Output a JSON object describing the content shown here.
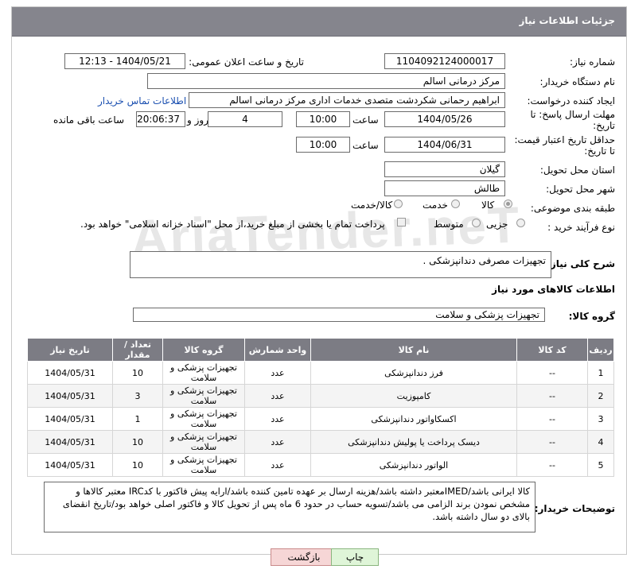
{
  "header": {
    "title": "جزئیات اطلاعات نیاز"
  },
  "fields": {
    "need_number_label": "شماره نیاز:",
    "need_number": "1104092124000017",
    "announce_label": "تاریخ و ساعت اعلان عمومی:",
    "announce_value": "1404/05/21 - 12:13",
    "buyer_org_label": "نام دستگاه خریدار:",
    "buyer_org": "مرکز درمانی اسالم",
    "creator_label": "ایجاد کننده درخواست:",
    "creator": "ابراهیم رحمانی شکردشت متصدی خدمات اداری مرکز درمانی اسالم",
    "contact_link": "اطلاعات تماس خریدار",
    "deadline_label_1": "مهلت ارسال پاسخ: تا",
    "deadline_label_2": "تاریخ:",
    "deadline_date": "1404/05/26",
    "time_label": "ساعت",
    "deadline_time": "10:00",
    "days_value": "4",
    "days_label": "روز و",
    "remaining_time": "20:06:37",
    "remaining_label": "ساعت باقی مانده",
    "validity_label_1": "حداقل تاریخ اعتبار قیمت:",
    "validity_label_2": "تا تاریخ:",
    "validity_date": "1404/06/31",
    "validity_time": "10:00",
    "province_label": "استان محل تحویل:",
    "province": "گیلان",
    "city_label": "شهر محل تحویل:",
    "city": "طالش",
    "category_label": "طبقه بندی موضوعی:",
    "category_options": [
      "کالا",
      "خدمت",
      "کالا/خدمت"
    ],
    "process_label": "نوع فرآیند خرید :",
    "process_options": [
      "جزیی",
      "متوسط"
    ],
    "payment_note": "پرداخت تمام یا بخشی از مبلغ خرید،از محل \"اسناد خزانه اسلامی\" خواهد بود."
  },
  "summary": {
    "label": "شرح کلی نیاز:",
    "value": "تجهیزات مصرفی دندانپزشکی ."
  },
  "goods": {
    "section_title": "اطلاعات کالاهای مورد نیاز",
    "group_label": "گروه کالا:",
    "group_value": "تجهیزات پزشکی و سلامت",
    "columns": [
      "ردیف",
      "کد کالا",
      "نام کالا",
      "واحد شمارش",
      "گروه کالا",
      "تعداد / مقدار",
      "تاریخ نیاز"
    ],
    "rows": [
      {
        "idx": "1",
        "code": "--",
        "name": "فرز دندانپزشکی",
        "unit": "عدد",
        "group": "تجهیزات پزشکی و سلامت",
        "qty": "10",
        "date": "1404/05/31"
      },
      {
        "idx": "2",
        "code": "--",
        "name": "کامپوزیت",
        "unit": "عدد",
        "group": "تجهیزات پزشکی و سلامت",
        "qty": "3",
        "date": "1404/05/31"
      },
      {
        "idx": "3",
        "code": "--",
        "name": "اکسکاواتور دندانپزشکی",
        "unit": "عدد",
        "group": "تجهیزات پزشکی و سلامت",
        "qty": "1",
        "date": "1404/05/31"
      },
      {
        "idx": "4",
        "code": "--",
        "name": "دیسک پرداخت یا پولیش دندانپزشکی",
        "unit": "عدد",
        "group": "تجهیزات پزشکی و سلامت",
        "qty": "10",
        "date": "1404/05/31"
      },
      {
        "idx": "5",
        "code": "--",
        "name": "الواتور دندانپزشکی",
        "unit": "عدد",
        "group": "تجهیزات پزشکی و سلامت",
        "qty": "10",
        "date": "1404/05/31"
      }
    ]
  },
  "buyer_notes": {
    "label": "توضیحات خریدار:",
    "value": "کالا ایرانی باشد/IMEDمعتبر داشته باشد/هزینه ارسال بر عهده تامین کننده باشد/ارایه پیش فاکتور با کدIRC معتبر کالاها و مشخص نمودن برند الزامی می باشد/تسویه حساب در حدود 6 ماه پس از تحویل کالا و فاکتور اصلی خواهد بود/تاریخ انقضای بالای دو سال داشته باشد."
  },
  "buttons": {
    "back": "بازگشت",
    "print": "چاپ"
  },
  "watermark": "AriaTender.neT"
}
